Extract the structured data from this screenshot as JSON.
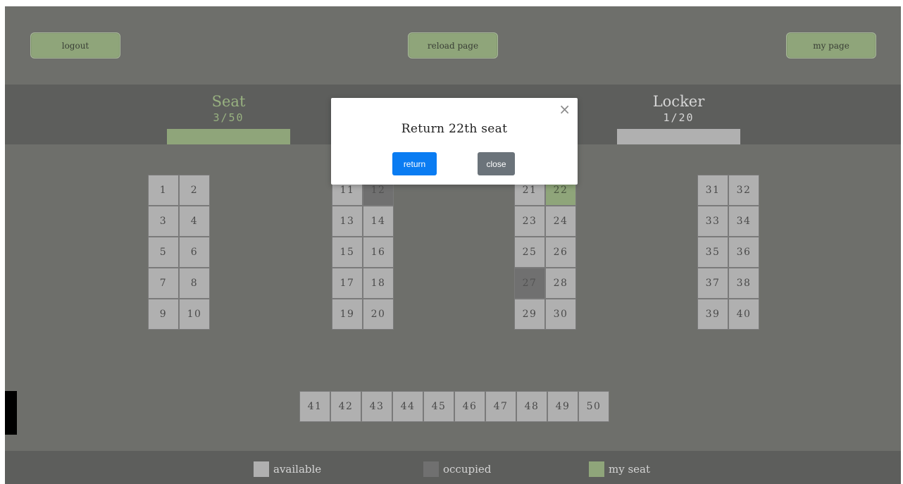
{
  "header": {
    "logout_label": "logout",
    "reload_label": "reload page",
    "mypage_label": "my page"
  },
  "stats": {
    "seat": {
      "title": "Seat",
      "count": "3/50"
    },
    "locker": {
      "title": "Locker",
      "count": "1/20"
    }
  },
  "seats": [
    {
      "n": "1",
      "s": "available"
    },
    {
      "n": "2",
      "s": "available"
    },
    {
      "n": "3",
      "s": "available"
    },
    {
      "n": "4",
      "s": "available"
    },
    {
      "n": "5",
      "s": "available"
    },
    {
      "n": "6",
      "s": "available"
    },
    {
      "n": "7",
      "s": "available"
    },
    {
      "n": "8",
      "s": "available"
    },
    {
      "n": "9",
      "s": "available"
    },
    {
      "n": "10",
      "s": "available"
    },
    {
      "n": "11",
      "s": "available"
    },
    {
      "n": "12",
      "s": "occupied"
    },
    {
      "n": "13",
      "s": "available"
    },
    {
      "n": "14",
      "s": "available"
    },
    {
      "n": "15",
      "s": "available"
    },
    {
      "n": "16",
      "s": "available"
    },
    {
      "n": "17",
      "s": "available"
    },
    {
      "n": "18",
      "s": "available"
    },
    {
      "n": "19",
      "s": "available"
    },
    {
      "n": "20",
      "s": "available"
    },
    {
      "n": "21",
      "s": "available"
    },
    {
      "n": "22",
      "s": "mine"
    },
    {
      "n": "23",
      "s": "available"
    },
    {
      "n": "24",
      "s": "available"
    },
    {
      "n": "25",
      "s": "available"
    },
    {
      "n": "26",
      "s": "available"
    },
    {
      "n": "27",
      "s": "occupied"
    },
    {
      "n": "28",
      "s": "available"
    },
    {
      "n": "29",
      "s": "available"
    },
    {
      "n": "30",
      "s": "available"
    },
    {
      "n": "31",
      "s": "available"
    },
    {
      "n": "32",
      "s": "available"
    },
    {
      "n": "33",
      "s": "available"
    },
    {
      "n": "34",
      "s": "available"
    },
    {
      "n": "35",
      "s": "available"
    },
    {
      "n": "36",
      "s": "available"
    },
    {
      "n": "37",
      "s": "available"
    },
    {
      "n": "38",
      "s": "available"
    },
    {
      "n": "39",
      "s": "available"
    },
    {
      "n": "40",
      "s": "available"
    },
    {
      "n": "41",
      "s": "available"
    },
    {
      "n": "42",
      "s": "available"
    },
    {
      "n": "43",
      "s": "available"
    },
    {
      "n": "44",
      "s": "available"
    },
    {
      "n": "45",
      "s": "available"
    },
    {
      "n": "46",
      "s": "available"
    },
    {
      "n": "47",
      "s": "available"
    },
    {
      "n": "48",
      "s": "available"
    },
    {
      "n": "49",
      "s": "available"
    },
    {
      "n": "50",
      "s": "available"
    }
  ],
  "legend": {
    "available": "available",
    "occupied": "occupied",
    "mine": "my seat"
  },
  "modal": {
    "title": "Return 22th seat",
    "return_label": "return",
    "close_label": "close",
    "close_icon": "×"
  },
  "colors": {
    "background": "#6e6f6b",
    "band": "#5d5e5c",
    "accent_green": "#8fa57a",
    "available": "#b0b0b0",
    "occupied": "#707070",
    "primary_button": "#0a7cf2",
    "secondary_button": "#6b737a"
  }
}
